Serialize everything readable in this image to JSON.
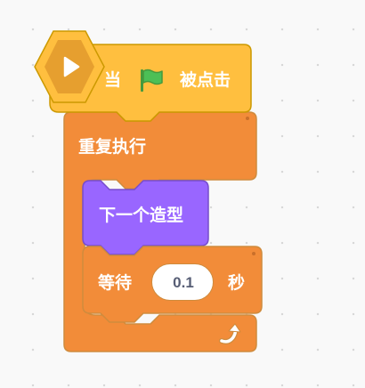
{
  "hat_block": {
    "prefix_label": "当",
    "flag_icon": "green-flag-icon",
    "suffix_label": "被点击",
    "extension_icon": "play-icon",
    "colors": {
      "fill": "#ffbf3f",
      "border": "#cc9900",
      "extension_fill": "#e69f2f"
    }
  },
  "forever_block": {
    "label": "重复执行",
    "loop_icon": "loop-arrow-icon",
    "colors": {
      "fill": "#f28c39",
      "border": "#cf8b3d"
    }
  },
  "looks_block": {
    "label": "下一个造型",
    "colors": {
      "fill": "#9966ff",
      "border": "#774dcb"
    }
  },
  "wait_block": {
    "prefix_label": "等待",
    "value": "0.1",
    "suffix_label": "秒",
    "colors": {
      "fill": "#f28c39",
      "border": "#cf8b3d"
    }
  }
}
